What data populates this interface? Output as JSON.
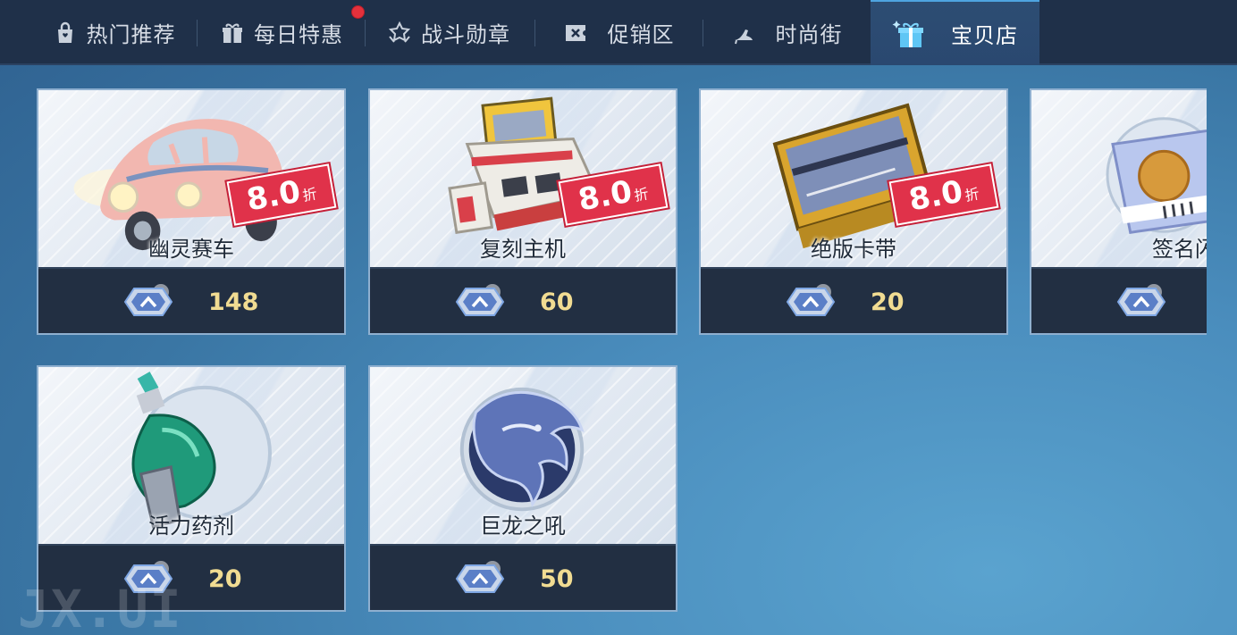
{
  "tabs": [
    {
      "label": "热门推荐",
      "icon": "shopping-bag-icon"
    },
    {
      "label": "每日特惠",
      "icon": "gift-box-icon",
      "notification": true
    },
    {
      "label": "战斗勋章",
      "icon": "medal-badge-icon"
    },
    {
      "label": "促销区",
      "icon": "ticket-x-icon"
    },
    {
      "label": "时尚街",
      "icon": "high-heel-icon"
    },
    {
      "label": "宝贝店",
      "icon": "gift-sparkle-icon",
      "active": true
    }
  ],
  "items": [
    {
      "name": "幽灵赛车",
      "price": "148",
      "discount": {
        "value": "8.0",
        "unit": "折"
      },
      "icon": "pink-beetle-car-icon"
    },
    {
      "name": "复刻主机",
      "price": "60",
      "discount": {
        "value": "8.0",
        "unit": "折"
      },
      "icon": "retro-console-icon"
    },
    {
      "name": "绝版卡带",
      "price": "20",
      "discount": {
        "value": "8.0",
        "unit": "折"
      },
      "icon": "game-cartridge-icon"
    },
    {
      "name": "签名闪",
      "price": "",
      "icon": "signed-card-icon"
    },
    {
      "name": "活力药剂",
      "price": "20",
      "icon": "green-potion-icon"
    },
    {
      "name": "巨龙之吼",
      "price": "50",
      "icon": "dragon-emblem-icon"
    }
  ],
  "currency_icon": "diamond-currency-icon",
  "watermark": "JX.UI",
  "colors": {
    "tabbar_bg": "#1f3049",
    "active_tab_bg": "#2d4d73",
    "price_text": "#f1dc92",
    "discount_badge": "#e0324a",
    "notification_dot": "#e4313c"
  }
}
